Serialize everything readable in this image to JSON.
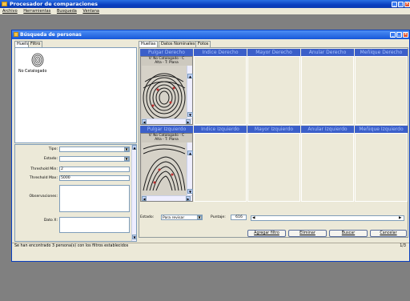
{
  "app": {
    "title": "Procesador de comparaciones",
    "menu": [
      "Archivo",
      "Herramientas",
      "Busqueda",
      "Ventana"
    ]
  },
  "window": {
    "title": "Búsqueda de personas"
  },
  "left_tabs": [
    "Huellas",
    "Filtro"
  ],
  "person": {
    "label": "No Catalogado"
  },
  "form": {
    "tipo_label": "Tipo:",
    "tipo_value": "",
    "estado_label": "Estado:",
    "estado_value": "",
    "thr_min_label": "Threshold Min:",
    "thr_min_value": "2",
    "thr_max_label": "Threshold Max:",
    "thr_max_value": "5000",
    "obs_label": "Observaciones:",
    "obs_value": "",
    "datox_label": "Dato X:",
    "datox_value": ""
  },
  "right_tabs": [
    "Huellas",
    "Datos Nominales",
    "Fotos"
  ],
  "row1": [
    "Pulgar Derecho",
    "Indice Derecho",
    "Mayor Derecho",
    "Anular Derecho",
    "Meñique Derecho"
  ],
  "row2": [
    "Pulgar Izquierdo",
    "Indice Izquierdo",
    "Mayor Izquierdo",
    "Anular Izquierdo",
    "Meñique Izquierdo"
  ],
  "fp_caption": {
    "line1": "V: No Catalogado - C",
    "line2": "Alta - T: Plana"
  },
  "bottom": {
    "estado_label": "Estado:",
    "estado_value": "Para revisar",
    "puntaje_label": "Puntaje:",
    "puntaje_value": "616"
  },
  "buttons": {
    "add": "Agregar filtro",
    "del": "Eliminar",
    "search": "Buscar",
    "cancel": "Cancelar"
  },
  "status": {
    "text": "Se han encontrado 3 persona(s) con los filtros establecidos",
    "page": "1/3"
  },
  "colors": {
    "titlebar": "#0a3fc0",
    "colhead": "#3b5fc9",
    "background": "#808080",
    "chrome": "#ece9d8"
  }
}
